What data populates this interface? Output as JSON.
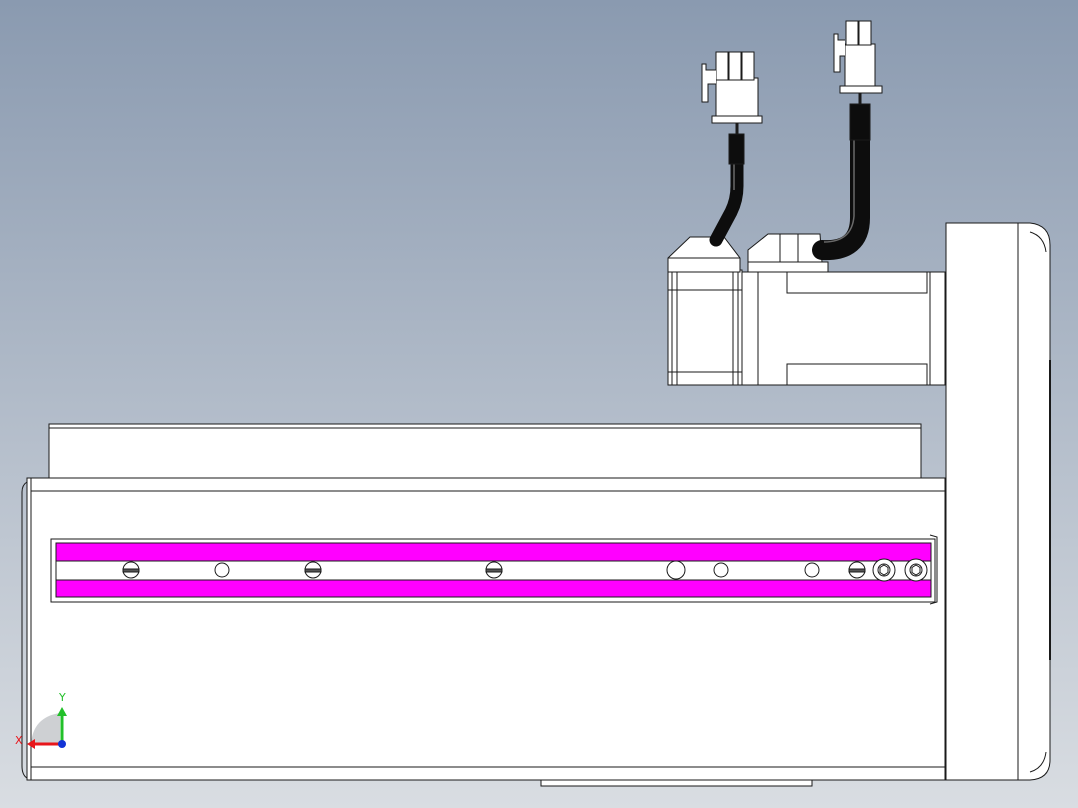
{
  "viewport": {
    "background_top": "#8a9ab0",
    "background_bottom": "#d9dde2"
  },
  "colors": {
    "body_fill": "#ffffff",
    "outline": "#1a1a1a",
    "slot_magenta": "#ff00ff",
    "cable": "#0d0d0d",
    "axis_x": "#e8161b",
    "axis_y": "#22c02a",
    "axis_z": "#1233d6",
    "triad_shade": "#b9bcc1"
  },
  "triad": {
    "x_label": "X",
    "y_label": "Y"
  },
  "parts": {
    "actuator_body": "linear-actuator-body",
    "motor": "servo-motor",
    "end_plate": "motor-mount-plate",
    "cable_left": "encoder-cable",
    "cable_right": "power-cable",
    "connector_left": "encoder-connector",
    "connector_right": "power-connector"
  }
}
